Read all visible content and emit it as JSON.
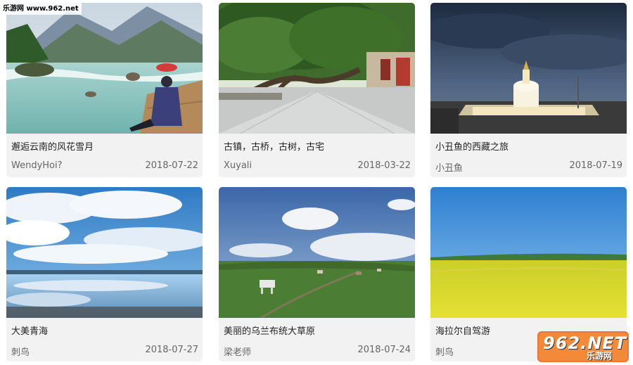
{
  "watermark": {
    "site": "乐游网 www.962.net",
    "logo_main": "962.NET",
    "logo_sub": "乐游网"
  },
  "cards": [
    {
      "title": "邂逅云南的风花雪月",
      "author": "WendyHoi?",
      "date": "2018-07-22",
      "image": "mountain-river-photo"
    },
    {
      "title": "古镇，古桥，古树，古宅",
      "author": "Xuyali",
      "date": "2018-03-22",
      "image": "ancient-town-photo"
    },
    {
      "title": "小丑鱼的西藏之旅",
      "author": "小丑鱼",
      "date": "2018-07-19",
      "image": "stupa-night-photo"
    },
    {
      "title": "大美青海",
      "author": "刺鸟",
      "date": "2018-07-27",
      "image": "lake-sky-photo"
    },
    {
      "title": "美丽的乌兰布统大草原",
      "author": "梁老师",
      "date": "2018-07-24",
      "image": "grassland-photo"
    },
    {
      "title": "海拉尔自驾游",
      "author": "刺鸟",
      "date": "",
      "image": "rapeseed-field-photo"
    }
  ]
}
